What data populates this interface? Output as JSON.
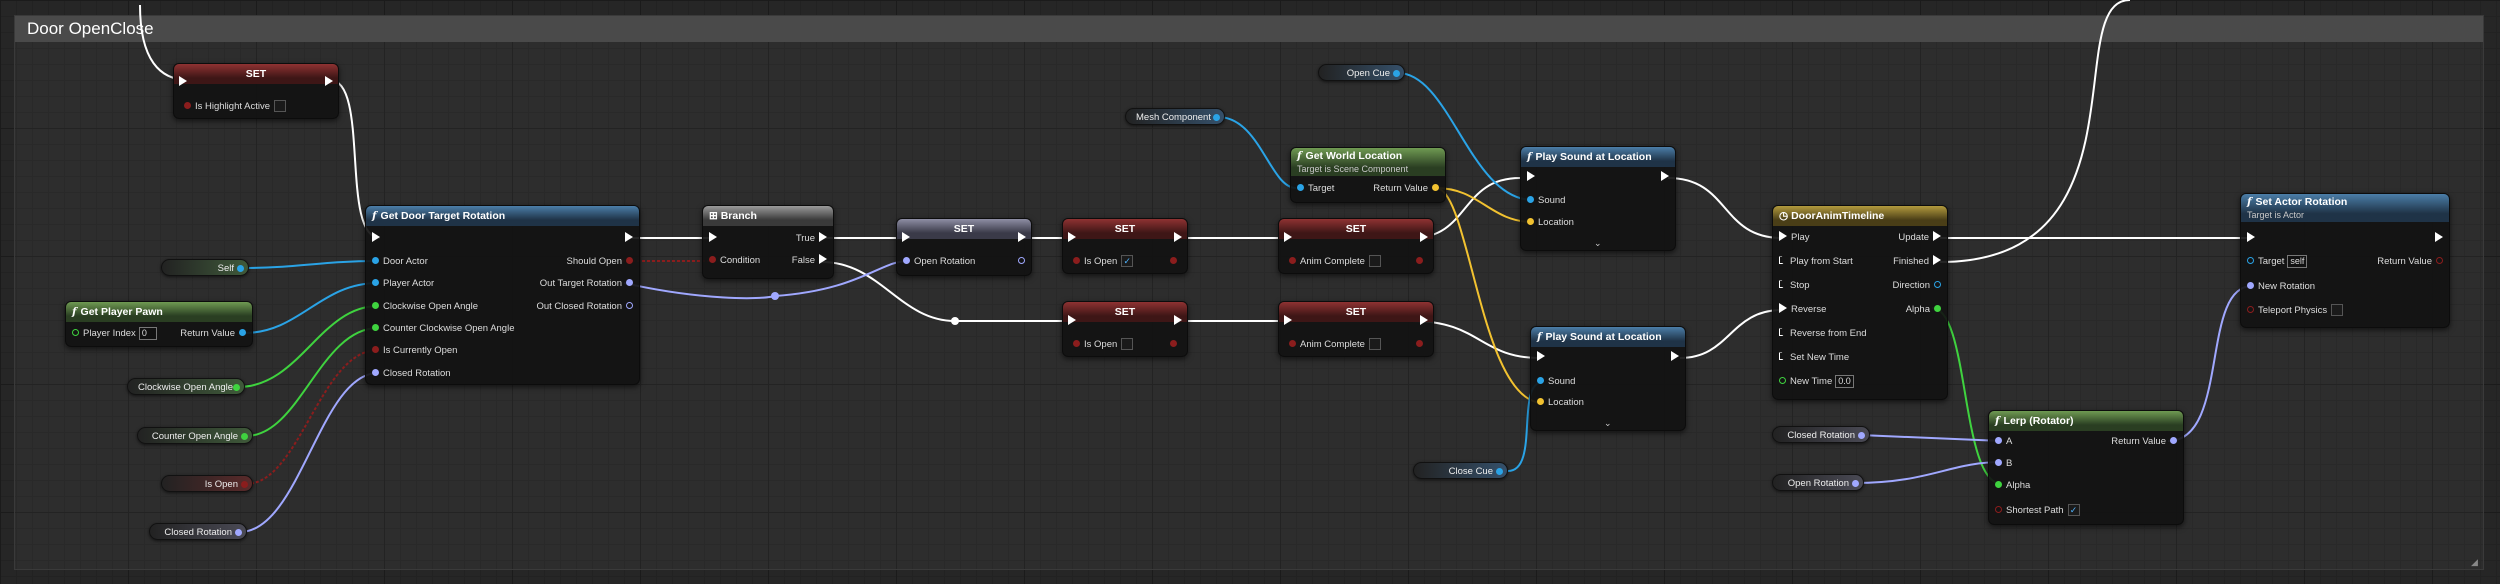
{
  "comment": {
    "title": "Door OpenClose"
  },
  "colors": {
    "exec": "#ffffff",
    "object": "#2aa3e6",
    "float": "#3fd33f",
    "bool": "#8b1d1d",
    "rotator": "#a0a8ff",
    "vector": "#f2c230",
    "sound": "#2aa3e6"
  },
  "nodes": {
    "set_highlight": {
      "title": "SET",
      "pin": "Is Highlight Active"
    },
    "get_door_target": {
      "title": "Get Door Target Rotation",
      "inputs": [
        "Door Actor",
        "Player Actor",
        "Clockwise Open Angle",
        "Counter Clockwise Open Angle",
        "Is Currently Open",
        "Closed Rotation"
      ],
      "outputs": [
        "Should Open",
        "Out Target Rotation",
        "Out Closed Rotation"
      ]
    },
    "branch": {
      "title": "Branch",
      "condition": "Condition",
      "true_label": "True",
      "false_label": "False"
    },
    "set_open_rotation": {
      "title": "SET",
      "pin": "Open Rotation"
    },
    "set_is_open_true": {
      "title": "SET",
      "pin": "Is Open",
      "check": "✓"
    },
    "set_is_open_false": {
      "title": "SET",
      "pin": "Is Open"
    },
    "set_anim_complete_1": {
      "title": "SET",
      "pin": "Anim Complete"
    },
    "set_anim_complete_2": {
      "title": "SET",
      "pin": "Anim Complete"
    },
    "get_world_location": {
      "title": "Get World Location",
      "subtitle": "Target is Scene Component",
      "target": "Target",
      "return": "Return Value"
    },
    "play_sound_1": {
      "title": "Play Sound at Location",
      "sound": "Sound",
      "location": "Location"
    },
    "play_sound_2": {
      "title": "Play Sound at Location",
      "sound": "Sound",
      "location": "Location"
    },
    "timeline": {
      "title": "DoorAnimTimeline",
      "inputs": [
        "Play",
        "Play from Start",
        "Stop",
        "Reverse",
        "Reverse from End",
        "Set New Time",
        "New Time"
      ],
      "outputs": [
        "Update",
        "Finished",
        "Direction",
        "Alpha"
      ],
      "new_time_value": "0.0"
    },
    "lerp": {
      "title": "Lerp (Rotator)",
      "a": "A",
      "b": "B",
      "alpha": "Alpha",
      "shortest": "Shortest Path",
      "return": "Return Value",
      "check": "✓"
    },
    "set_actor_rotation": {
      "title": "Set Actor Rotation",
      "subtitle": "Target is Actor",
      "target": "Target",
      "target_value": "self",
      "new_rotation": "New Rotation",
      "teleport": "Teleport Physics",
      "return": "Return Value"
    },
    "get_player_pawn": {
      "title": "Get Player Pawn",
      "player_index": "Player Index",
      "player_index_value": "0",
      "return": "Return Value"
    }
  },
  "variables": {
    "self": "Self",
    "clockwise": "Clockwise Open Angle",
    "counter": "Counter Open Angle",
    "is_open": "Is Open",
    "closed_rotation_1": "Closed Rotation",
    "mesh_component": "Mesh Component",
    "open_cue": "Open Cue",
    "close_cue": "Close Cue",
    "closed_rotation_2": "Closed Rotation",
    "open_rotation": "Open Rotation"
  }
}
